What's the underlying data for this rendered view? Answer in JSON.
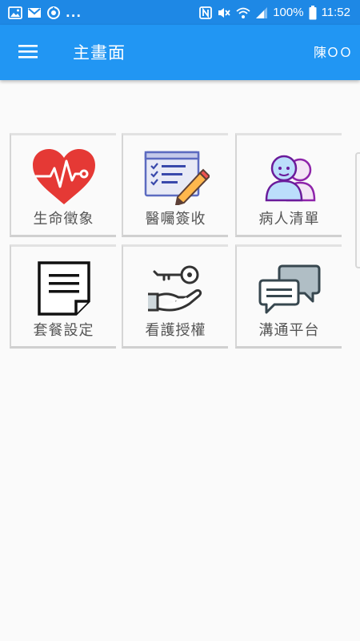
{
  "status_bar": {
    "battery": "100%",
    "time": "11:52",
    "dots": "...",
    "icons": [
      "gallery-icon",
      "mail-icon",
      "sync-icon",
      "nfc-icon",
      "mute-icon",
      "wifi-icon",
      "signal-icon"
    ]
  },
  "app_bar": {
    "menu_icon": "hamburger-icon",
    "title": "主畫面",
    "user": "陳ＯＯ"
  },
  "colors": {
    "status_bar": "#1e88e5",
    "app_bar": "#2196f3",
    "background": "#fafafa",
    "label": "#555555"
  },
  "menu": {
    "items": [
      {
        "label": "生命徵象",
        "icon": "heart-pulse-icon"
      },
      {
        "label": "醫囑簽收",
        "icon": "checklist-pencil-icon"
      },
      {
        "label": "病人清單",
        "icon": "patients-icon"
      },
      {
        "label": "套餐設定",
        "icon": "document-icon"
      },
      {
        "label": "看護授權",
        "icon": "key-hand-icon"
      },
      {
        "label": "溝通平台",
        "icon": "chat-bubbles-icon"
      }
    ]
  }
}
